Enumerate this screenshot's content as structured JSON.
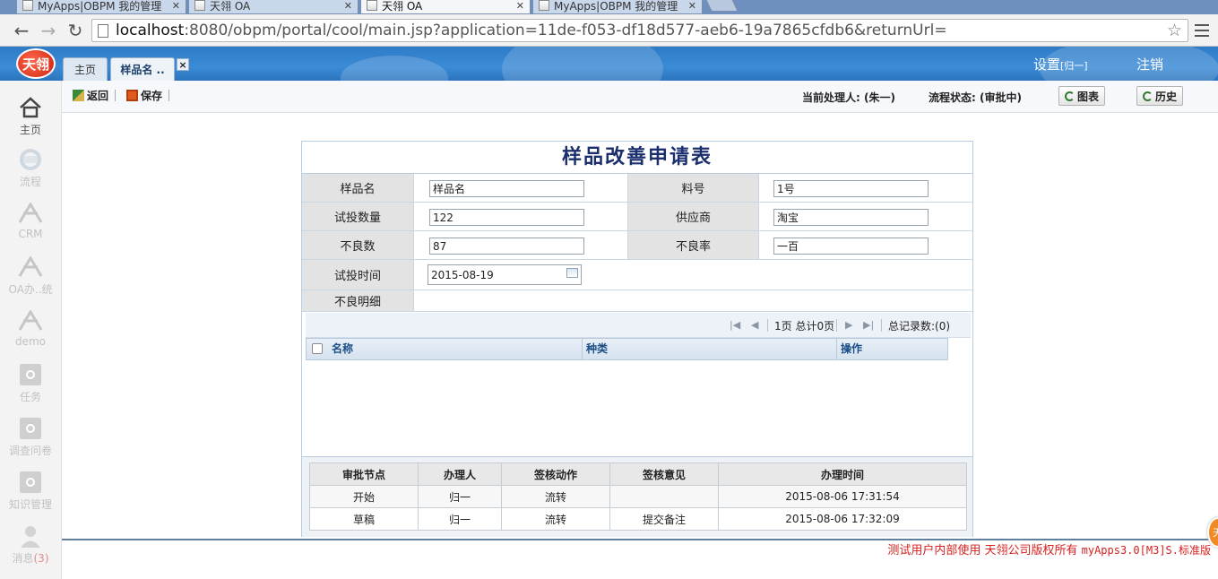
{
  "browser": {
    "tabs": [
      {
        "title": "MyApps|OBPM 我的管理"
      },
      {
        "title": "天翎 OA"
      },
      {
        "title": "天翎 OA"
      },
      {
        "title": "MyApps|OBPM 我的管理"
      }
    ],
    "url_host": "localhost",
    "url_rest": ":8080/obpm/portal/cool/main.jsp?application=11de-f053-df18d577-aeb6-19a7865cfdb6&returnUrl="
  },
  "header": {
    "logo_text": "天翎",
    "tab_home": "主页",
    "tab_current": "样品名 ..",
    "tab_close": "×",
    "settings": "设置",
    "settings_user": "[归一]",
    "logout": "注销"
  },
  "sidebar": {
    "items": [
      {
        "label": "主页",
        "icon": "home-icon"
      },
      {
        "label": "流程",
        "icon": "flow-icon"
      },
      {
        "label": "CRM",
        "icon": "app-icon"
      },
      {
        "label": "OA办..统",
        "icon": "app-icon"
      },
      {
        "label": "demo",
        "icon": "app-icon"
      },
      {
        "label": "任务",
        "icon": "gear-icon"
      },
      {
        "label": "调查问卷",
        "icon": "gear-icon"
      },
      {
        "label": "知识管理",
        "icon": "gear-icon"
      },
      {
        "label": "消息",
        "count": "(3)",
        "icon": "user-icon"
      }
    ]
  },
  "actionbar": {
    "back": "返回",
    "save": "保存",
    "handler": "当前处理人: (朱一)",
    "status": "流程状态: (审批中)",
    "chart_btn": "图表",
    "history_btn": "历史"
  },
  "form": {
    "title": "样品改善申请表",
    "labels": {
      "sample_name": "样品名",
      "material_no": "料号",
      "trial_qty": "试投数量",
      "supplier": "供应商",
      "defect_qty": "不良数",
      "defect_rate": "不良率",
      "trial_time": "试投时间",
      "defect_detail": "不良明细"
    },
    "values": {
      "sample_name": "样品名",
      "material_no": "1号",
      "trial_qty": "122",
      "supplier": "淘宝",
      "defect_qty": "87",
      "defect_rate": "一百",
      "trial_time": "2015-08-19"
    },
    "pager": {
      "info": "1页 总计0页",
      "total": "总记录数:(0)"
    },
    "grid_columns": [
      "名称",
      "种类",
      "操作"
    ]
  },
  "approval": {
    "headers": [
      "审批节点",
      "办理人",
      "签核动作",
      "签核意见",
      "办理时间"
    ],
    "rows": [
      {
        "node": "开始",
        "handler": "归一",
        "action": "流转",
        "opinion": "",
        "time": "2015-08-06 17:31:54"
      },
      {
        "node": "草稿",
        "handler": "归一",
        "action": "流转",
        "opinion": "提交备注",
        "time": "2015-08-06 17:32:09"
      }
    ]
  },
  "footer": {
    "text": "测试用户内部使用 天翎公司版权所有 ",
    "version": "myApps3.0[M3]S.标准版"
  },
  "float_badge": "天"
}
